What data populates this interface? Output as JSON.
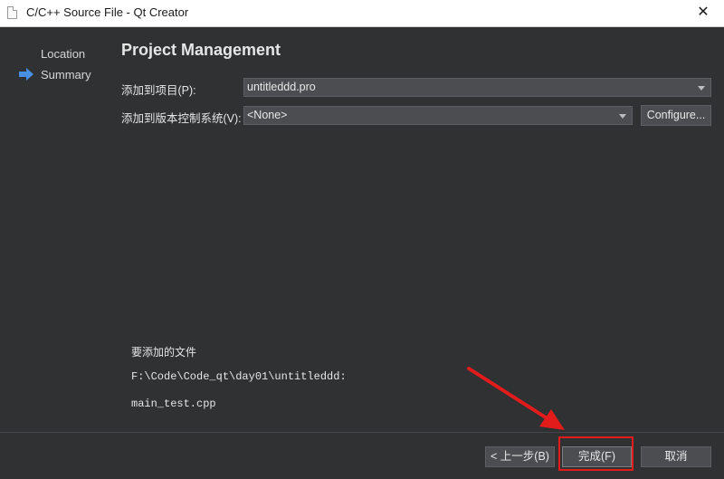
{
  "window": {
    "title": "C/C++ Source File - Qt Creator",
    "close_glyph": "✕"
  },
  "sidebar": {
    "items": [
      {
        "label": "Location",
        "current": false
      },
      {
        "label": "Summary",
        "current": true
      }
    ]
  },
  "main": {
    "title": "Project Management",
    "add_to_project_label": "添加到项目(P):",
    "project_value": "untitleddd.pro",
    "vcs_label": "添加到版本控制系统(V):",
    "vcs_value": "<None>",
    "configure_label": "Configure...",
    "files_heading": "要添加的文件",
    "files_path": "F:\\Code\\Code_qt\\day01\\untitleddd:",
    "files_name": "main_test.cpp"
  },
  "buttons": {
    "back": "< 上一步(B)",
    "finish": "完成(F)",
    "cancel": "取消"
  },
  "colors": {
    "background": "#2f3133",
    "accent_arrow": "#4a90e2",
    "annotation": "#e21b1b"
  },
  "icons": {
    "current_step": "right-arrow-icon",
    "file": "file-icon",
    "close": "close-icon",
    "dropdown": "chevron-down-icon"
  }
}
